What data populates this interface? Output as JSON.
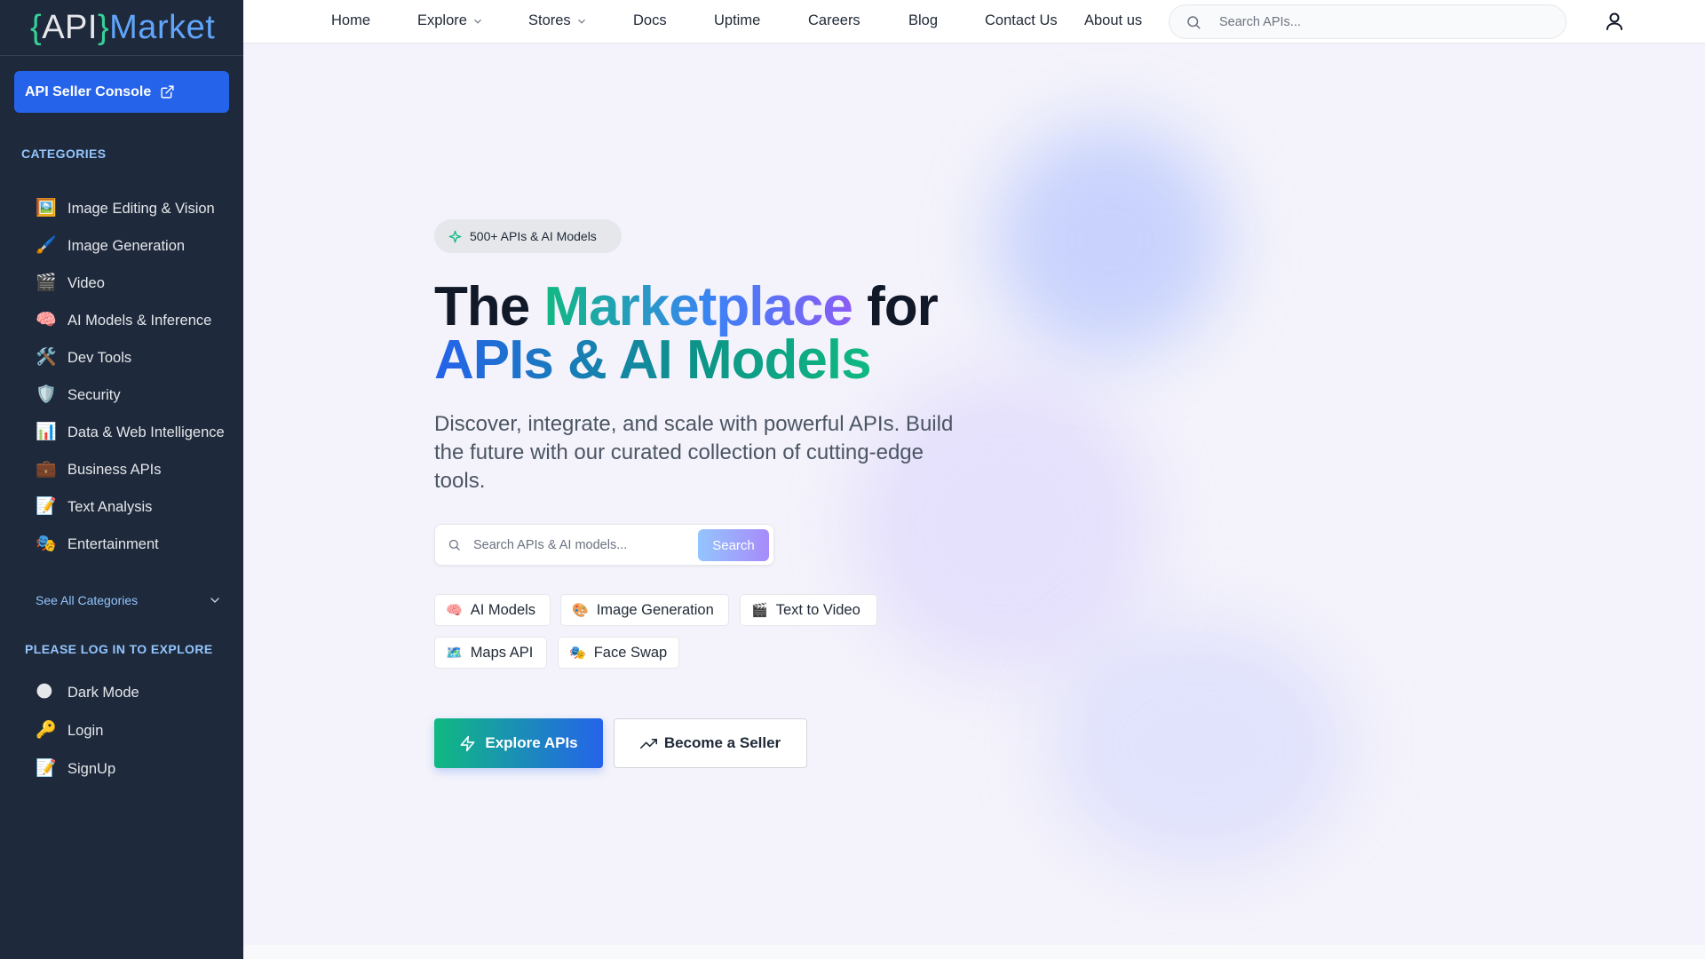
{
  "logo": {
    "open": "{",
    "api": "API",
    "close": "}",
    "market": "Market"
  },
  "sidebar": {
    "seller_console": "API Seller Console",
    "categories_title": "CATEGORIES",
    "categories": [
      {
        "icon": "🖼️",
        "label": "Image Editing & Vision"
      },
      {
        "icon": "🖌️",
        "label": "Image Generation"
      },
      {
        "icon": "🎬",
        "label": "Video"
      },
      {
        "icon": "🧠",
        "label": "AI Models & Inference"
      },
      {
        "icon": "🛠️",
        "label": "Dev Tools"
      },
      {
        "icon": "🛡️",
        "label": "Security"
      },
      {
        "icon": "📊",
        "label": "Data & Web Intelligence"
      },
      {
        "icon": "💼",
        "label": "Business APIs"
      },
      {
        "icon": "📝",
        "label": "Text Analysis"
      },
      {
        "icon": "🎭",
        "label": "Entertainment"
      }
    ],
    "see_all": "See All Categories",
    "login_title": "PLEASE LOG IN TO EXPLORE",
    "login_items": [
      {
        "icon": "🌑",
        "label": "Dark Mode"
      },
      {
        "icon": "🔑",
        "label": "Login"
      },
      {
        "icon": "📝",
        "label": "SignUp"
      }
    ]
  },
  "nav": {
    "items": [
      "Home",
      "Explore",
      "Stores",
      "Docs",
      "Uptime",
      "Careers",
      "Blog",
      "Contact Us",
      "About us"
    ],
    "search_placeholder": "Search APIs..."
  },
  "hero": {
    "badge": "500+ APIs & AI Models",
    "title_the": "The ",
    "title_marketplace": "Marketplace",
    "title_for": " for",
    "title_line2": "APIs & AI Models",
    "subtitle": "Discover, integrate, and scale with powerful APIs. Build the future with our curated collection of cutting-edge tools.",
    "search_placeholder": "Search APIs & AI models...",
    "search_button": "Search",
    "chips": [
      {
        "icon": "🧠",
        "label": "AI Models"
      },
      {
        "icon": "🎨",
        "label": "Image Generation"
      },
      {
        "icon": "🎬",
        "label": "Text to Video"
      },
      {
        "icon": "🗺️",
        "label": "Maps API"
      },
      {
        "icon": "🎭",
        "label": "Face Swap"
      }
    ],
    "explore_button": "Explore APIs",
    "seller_button": "Become a Seller"
  },
  "colors": {
    "sidebar_bg": "#1e293b",
    "primary": "#2563eb",
    "accent_green": "#10b981",
    "accent_purple": "#8b5cf6"
  }
}
